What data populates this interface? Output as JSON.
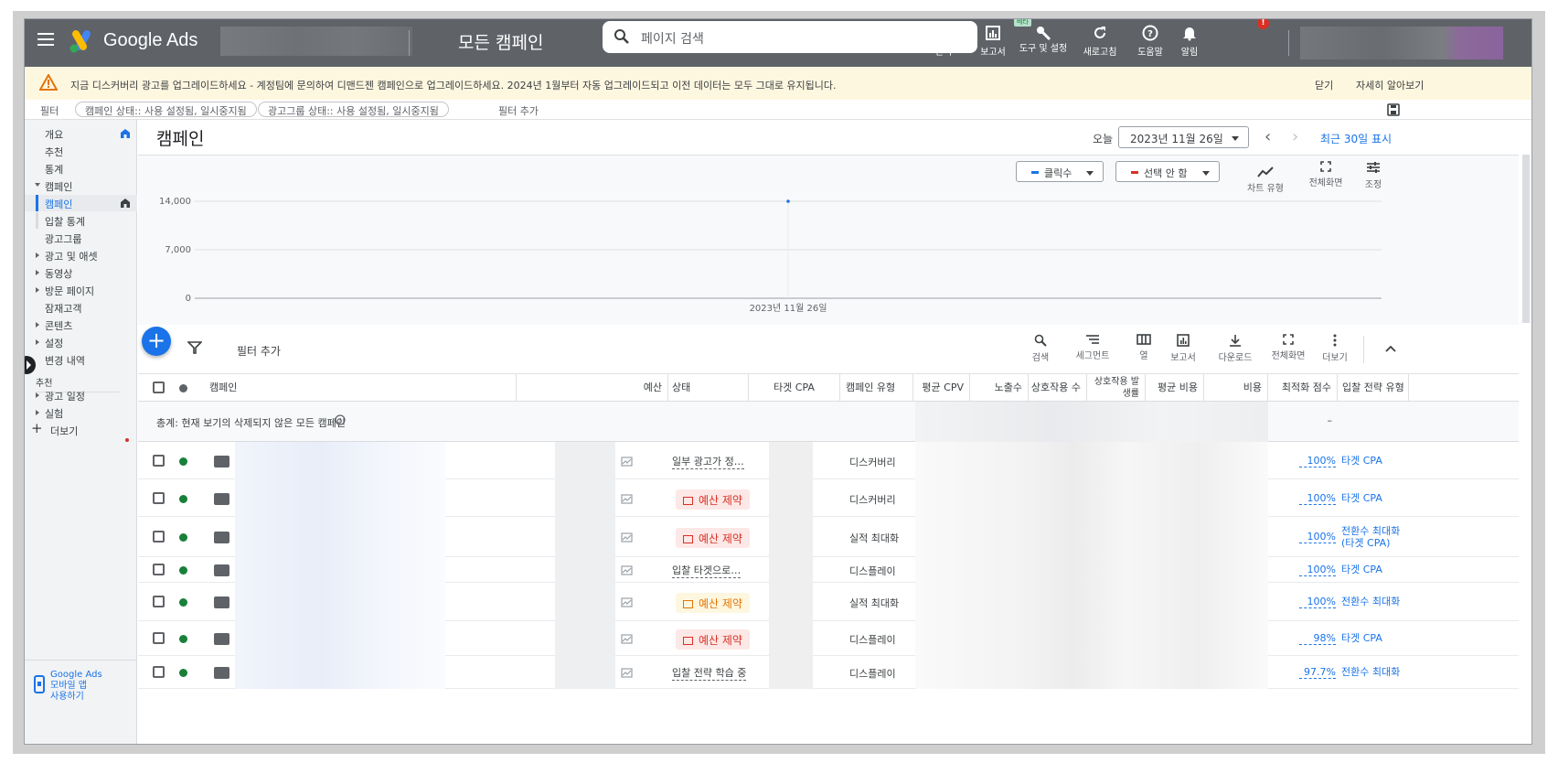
{
  "topbar": {
    "brand": "Google Ads",
    "page_title": "모든 캠페인",
    "search_placeholder": "페이지 검색",
    "tools": [
      {
        "label": "간격",
        "icon": "compact-view-icon",
        "badge": "베타"
      },
      {
        "label": "보고서",
        "icon": "reports-icon"
      },
      {
        "label": "도구 및 설정",
        "icon": "wrench-icon"
      },
      {
        "label": "새로고침",
        "icon": "refresh-icon"
      },
      {
        "label": "도움말",
        "icon": "help-icon"
      },
      {
        "label": "알림",
        "icon": "bell-icon",
        "badge": "!"
      }
    ]
  },
  "banner": {
    "message": "지금 디스커버리 광고를 업그레이드하세요 - 계정팀에 문의하여 디맨드젠 캠페인으로 업그레이드하세요. 2024년 1월부터 자동 업그레이드되고 이전 데이터는 모두 그대로 유지됩니다.",
    "dismiss": "닫기",
    "learn_more": "자세히 알아보기"
  },
  "filters": {
    "label": "필터",
    "chips": [
      "캠페인 상태:: 사용 설정됨, 일시중지됨",
      "광고그룹 상태:: 사용 설정됨, 일시중지됨"
    ],
    "add": "필터 추가"
  },
  "sidebar": {
    "items": [
      {
        "label": "개요",
        "home": true
      },
      {
        "label": "추천"
      },
      {
        "label": "통계"
      },
      {
        "label": "캠페인",
        "caret": "down"
      },
      {
        "label": "캠페인",
        "active": true,
        "home": true
      },
      {
        "label": "입찰 통계"
      },
      {
        "label": "광고그룹"
      },
      {
        "label": "광고 및 애셋",
        "caret": "right"
      },
      {
        "label": "동영상",
        "caret": "right"
      },
      {
        "label": "방문 페이지",
        "caret": "right"
      },
      {
        "label": "잠재고객"
      },
      {
        "label": "콘텐츠",
        "caret": "right"
      },
      {
        "label": "설정",
        "caret": "right"
      },
      {
        "label": "변경 내역"
      },
      {
        "label": "추천"
      },
      {
        "label": "광고 일정",
        "caret": "right"
      },
      {
        "label": "실험",
        "caret": "right"
      },
      {
        "label": "더보기",
        "plus": true
      }
    ],
    "mobile_line1": "Google Ads",
    "mobile_line2": "모바일 앱",
    "mobile_line3": "사용하기"
  },
  "main": {
    "title": "캠페인",
    "today_label": "오늘",
    "date": "2023년 11월 26일",
    "last30": "최근 30일 표시",
    "metric1": "클릭수",
    "metric2": "선택 안 함",
    "chart_tools": [
      "차트 유형",
      "전체화면",
      "조정"
    ],
    "table_tools": [
      "검색",
      "세그먼트",
      "열",
      "보고서",
      "다운로드",
      "전체화면",
      "더보기"
    ],
    "add_filter": "필터 추가"
  },
  "chart_data": {
    "type": "line",
    "x": [
      "2023년 11월 26일"
    ],
    "series": [
      {
        "values": [
          14000
        ],
        "color": "#1a73e8"
      }
    ],
    "yticks": [
      "14,000",
      "7,000",
      "0"
    ],
    "ylim": [
      0,
      14000
    ],
    "grid": true
  },
  "table": {
    "headers": [
      "캠페인",
      "예산",
      "상태",
      "타겟 CPA",
      "캠페인 유형",
      "평균 CPV",
      "노출수",
      "상호작용 수",
      "상호작용 발생률",
      "평균 비용",
      "비용",
      "최적화 점수",
      "입찰 전략 유형"
    ],
    "total_label": "총계: 현재 보기의 삭제되지 않은 모든 캠페인",
    "total_opt": "–",
    "rows": [
      {
        "status": "일부 광고가 정…",
        "status_kind": "text",
        "type": "디스커버리",
        "opt": "100%",
        "bid": "타겟 CPA"
      },
      {
        "status": "예산 제약",
        "status_kind": "red",
        "type": "디스커버리",
        "opt": "100%",
        "bid": "타겟 CPA"
      },
      {
        "status": "예산 제약",
        "status_kind": "red",
        "type": "실적 최대화",
        "opt": "100%",
        "bid": "전환수 최대화 (타겟 CPA)"
      },
      {
        "status": "입찰 타겟으로…",
        "status_kind": "text",
        "type": "디스플레이",
        "opt": "100%",
        "bid": "타겟 CPA"
      },
      {
        "status": "예산 제약",
        "status_kind": "yellow",
        "type": "실적 최대화",
        "opt": "100%",
        "bid": "전환수 최대화"
      },
      {
        "status": "예산 제약",
        "status_kind": "red",
        "type": "디스플레이",
        "opt": "98%",
        "bid": "타겟 CPA"
      },
      {
        "status": "입찰 전략 학습 중",
        "status_kind": "text",
        "type": "디스플레이",
        "opt": "97.7%",
        "bid": "전환수 최대화"
      }
    ]
  }
}
